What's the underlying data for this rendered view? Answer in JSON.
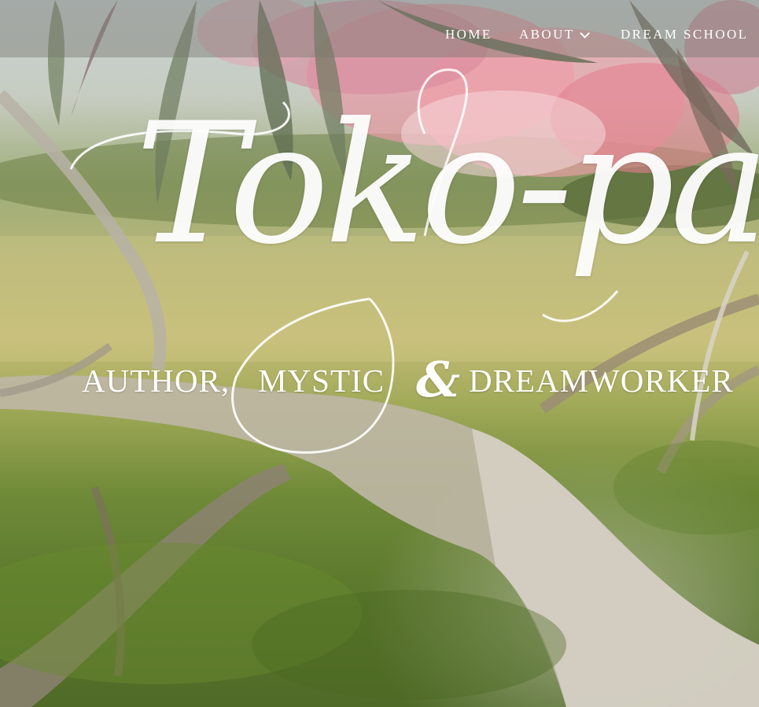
{
  "nav": {
    "items": [
      {
        "label": "HOME"
      },
      {
        "label": "ABOUT",
        "icon": "chevron-down-icon"
      },
      {
        "label": "DREAM SCHOOL"
      }
    ]
  },
  "logo": {
    "script": "Toko-pa"
  },
  "tagline": {
    "part1": "AUTHOR,",
    "part2": "MYSTIC",
    "amp": "&",
    "part3": "DREAMWORKER"
  },
  "colors": {
    "nav_text": "#ffffff",
    "nav_bar": "#78786e",
    "flower_pink": "#e07f8f",
    "leaf_green": "#6e7d5c",
    "grass_green": "#5d7a2e"
  }
}
